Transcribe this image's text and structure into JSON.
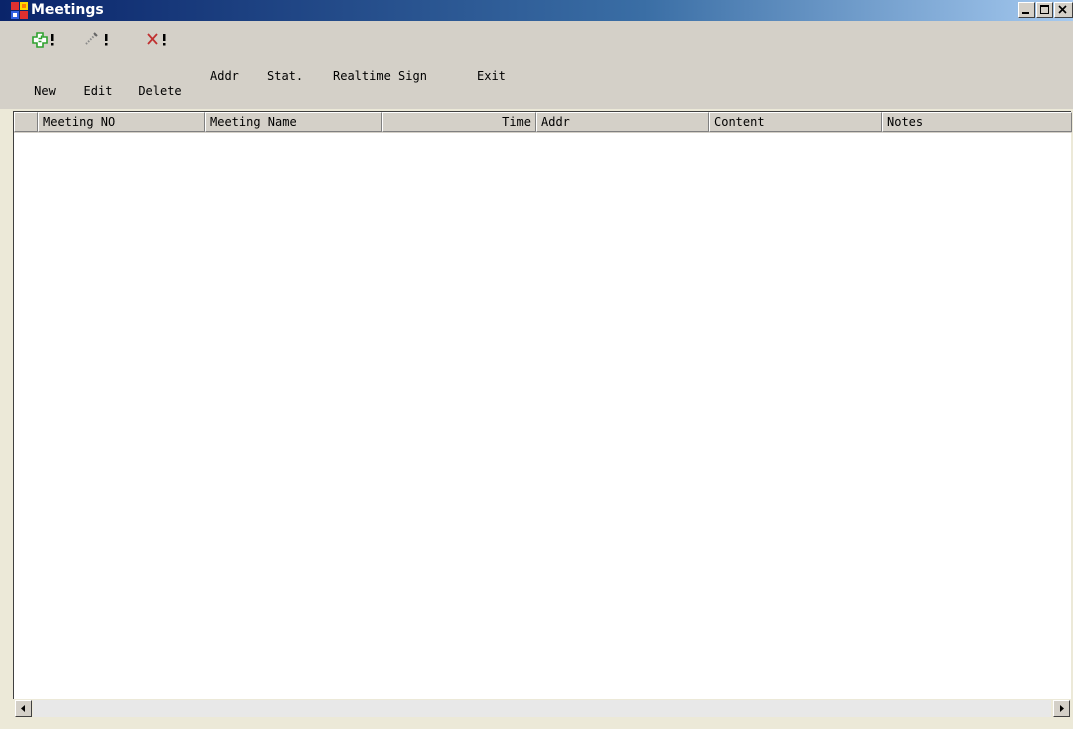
{
  "window": {
    "title": "Meetings"
  },
  "toolbar": {
    "new_label": "New",
    "edit_label": "Edit",
    "delete_label": "Delete",
    "addr_label": "Addr",
    "stat_label": "Stat.",
    "realtime_sign_label": "Realtime Sign",
    "exit_label": "Exit"
  },
  "grid": {
    "columns": [
      "Meeting NO",
      "Meeting Name",
      "Time",
      "Addr",
      "Content",
      "Notes"
    ],
    "rows": []
  },
  "icons": {
    "app": "meetings-app-icon",
    "new": "plus-icon",
    "edit": "pencil-icon",
    "delete": "x-icon"
  },
  "colors": {
    "titlebar_start": "#0a246a",
    "titlebar_end": "#a6caf0",
    "chrome": "#d4d0c8",
    "new_icon": "#2ea12e",
    "delete_icon": "#c03030"
  }
}
